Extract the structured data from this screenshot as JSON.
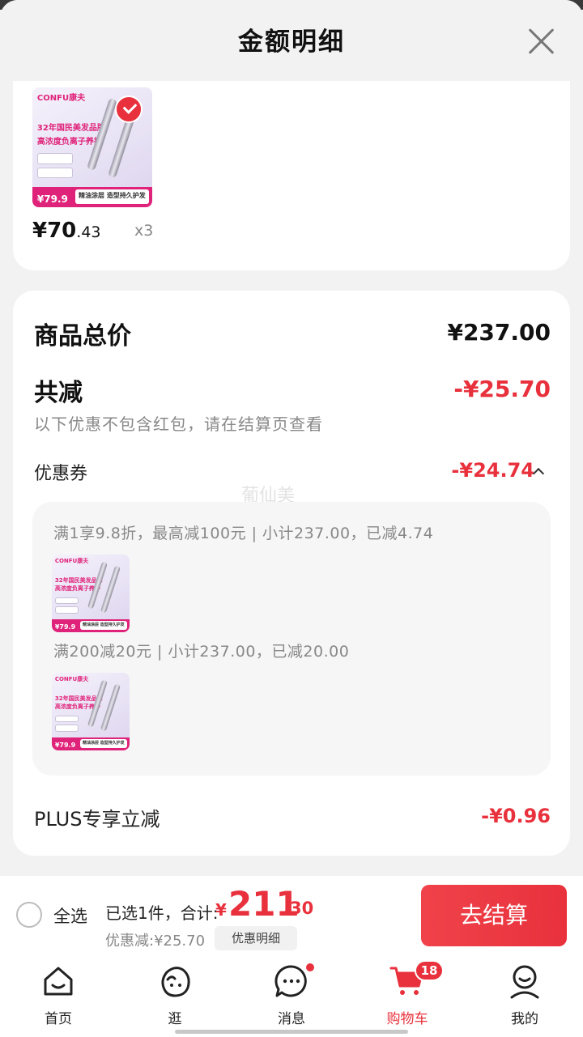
{
  "sheet": {
    "title": "金额明细"
  },
  "product": {
    "brand": "CONFU",
    "brand_cn": "康夫",
    "headline1": "32年国民美发品牌",
    "headline2": "高浓度负离子养护",
    "promo_price": "¥79.9",
    "slogan": "精油涂层 造型持久护发",
    "price_int": "¥70",
    "price_dec": ".43",
    "quantity": "x3"
  },
  "summary": {
    "total_label": "商品总价",
    "total_value": "¥237.00",
    "reduce_label": "共减",
    "reduce_value": "-¥25.70",
    "note": "以下优惠不包含红包，请在结算页查看",
    "coupon_label": "优惠券",
    "coupon_value": "-¥24.74",
    "watermark": "葡仙美",
    "rules": [
      "满1享9.8折，最高减100元 | 小计237.00，已减4.74",
      "满200减20元 | 小计237.00，已减20.00"
    ],
    "plus_label": "PLUS专享立减",
    "plus_value": "-¥0.96"
  },
  "checkout": {
    "select_all": "全选",
    "selected_text": "已选1件，合计:",
    "total_symbol": "¥",
    "total_int": "211",
    "total_dec": ".30",
    "discount_text": "优惠减:¥25.70",
    "detail_button": "优惠明细",
    "checkout_button": "去结算"
  },
  "tabs": [
    {
      "label": "首页",
      "icon": "home-icon"
    },
    {
      "label": "逛",
      "icon": "discover-icon"
    },
    {
      "label": "消息",
      "icon": "message-icon"
    },
    {
      "label": "购物车",
      "icon": "cart-icon",
      "badge": "18"
    },
    {
      "label": "我的",
      "icon": "profile-icon"
    }
  ],
  "colors": {
    "accent": "#e8313c",
    "brand_pink": "#e0237a"
  }
}
